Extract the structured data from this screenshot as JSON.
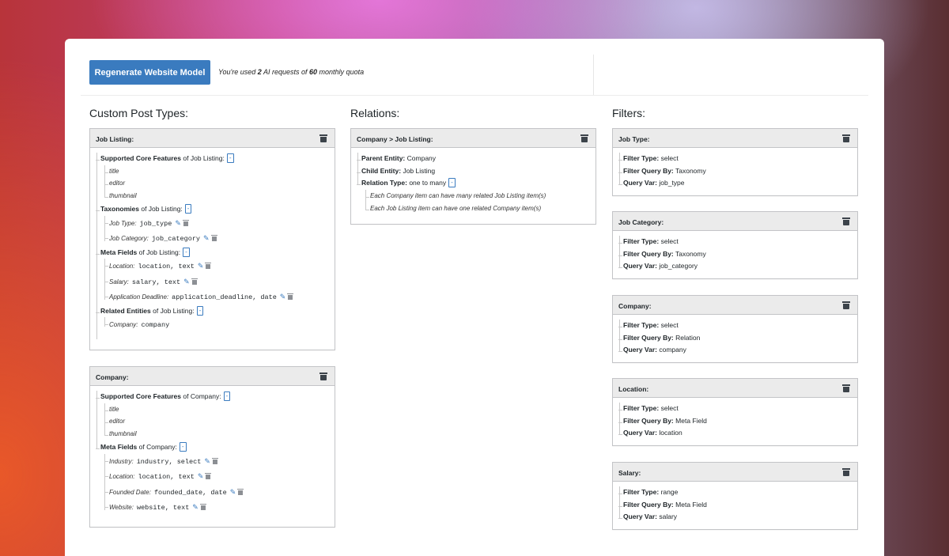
{
  "toolbar": {
    "regen_label": "Regenerate Website Model",
    "quota_prefix": "You're used",
    "quota_used": "2",
    "quota_mid": "AI requests of",
    "quota_total": "60",
    "quota_suffix": "monthly quota"
  },
  "cpt": {
    "title": "Custom Post Types:",
    "job": {
      "header": "Job Listing:",
      "features_label": "Supported Core Features",
      "features_of": "of Job Listing:",
      "features": [
        "title",
        "editor",
        "thumbnail"
      ],
      "tax_label": "Taxonomies",
      "tax_of": "of Job Listing:",
      "taxonomies": [
        {
          "label": "Job Type:",
          "value": "job_type"
        },
        {
          "label": "Job Category:",
          "value": "job_category"
        }
      ],
      "meta_label": "Meta Fields",
      "meta_of": "of Job Listing:",
      "meta": [
        {
          "label": "Location:",
          "value": "location, text"
        },
        {
          "label": "Salary:",
          "value": "salary, text"
        },
        {
          "label": "Application Deadline:",
          "value": "application_deadline, date"
        }
      ],
      "rel_label": "Related Entities",
      "rel_of": "of Job Listing:",
      "related": [
        {
          "label": "Company:",
          "value": "company"
        }
      ]
    },
    "company": {
      "header": "Company:",
      "features_label": "Supported Core Features",
      "features_of": "of Company:",
      "features": [
        "title",
        "editor",
        "thumbnail"
      ],
      "meta_label": "Meta Fields",
      "meta_of": "of Company:",
      "meta": [
        {
          "label": "Industry:",
          "value": "industry, select"
        },
        {
          "label": "Location:",
          "value": "location, text"
        },
        {
          "label": "Founded Date:",
          "value": "founded_date, date"
        },
        {
          "label": "Website:",
          "value": "website, text"
        }
      ]
    }
  },
  "relations": {
    "title": "Relations:",
    "box": {
      "header": "Company > Job Listing:",
      "parent_label": "Parent Entity:",
      "parent_value": "Company",
      "child_label": "Child Entity:",
      "child_value": "Job Listing",
      "type_label": "Relation Type:",
      "type_value": "one to many",
      "notes": [
        "Each Company item can have many related Job Listing item(s)",
        "Each Job Listing item can have one related Company item(s)"
      ]
    }
  },
  "filters": {
    "title": "Filters:",
    "labels": {
      "type": "Filter Type:",
      "query_by": "Filter Query By:",
      "query_var": "Query Var:"
    },
    "items": [
      {
        "header": "Job Type:",
        "type": "select",
        "query_by": "Taxonomy",
        "query_var": "job_type"
      },
      {
        "header": "Job Category:",
        "type": "select",
        "query_by": "Taxonomy",
        "query_var": "job_category"
      },
      {
        "header": "Company:",
        "type": "select",
        "query_by": "Relation",
        "query_var": "company"
      },
      {
        "header": "Location:",
        "type": "select",
        "query_by": "Meta Field",
        "query_var": "location"
      },
      {
        "header": "Salary:",
        "type": "range",
        "query_by": "Meta Field",
        "query_var": "salary"
      }
    ]
  },
  "colors": {
    "accent": "#3a7bbf",
    "header_bg": "#ebebeb",
    "border": "#c3c4c7"
  }
}
